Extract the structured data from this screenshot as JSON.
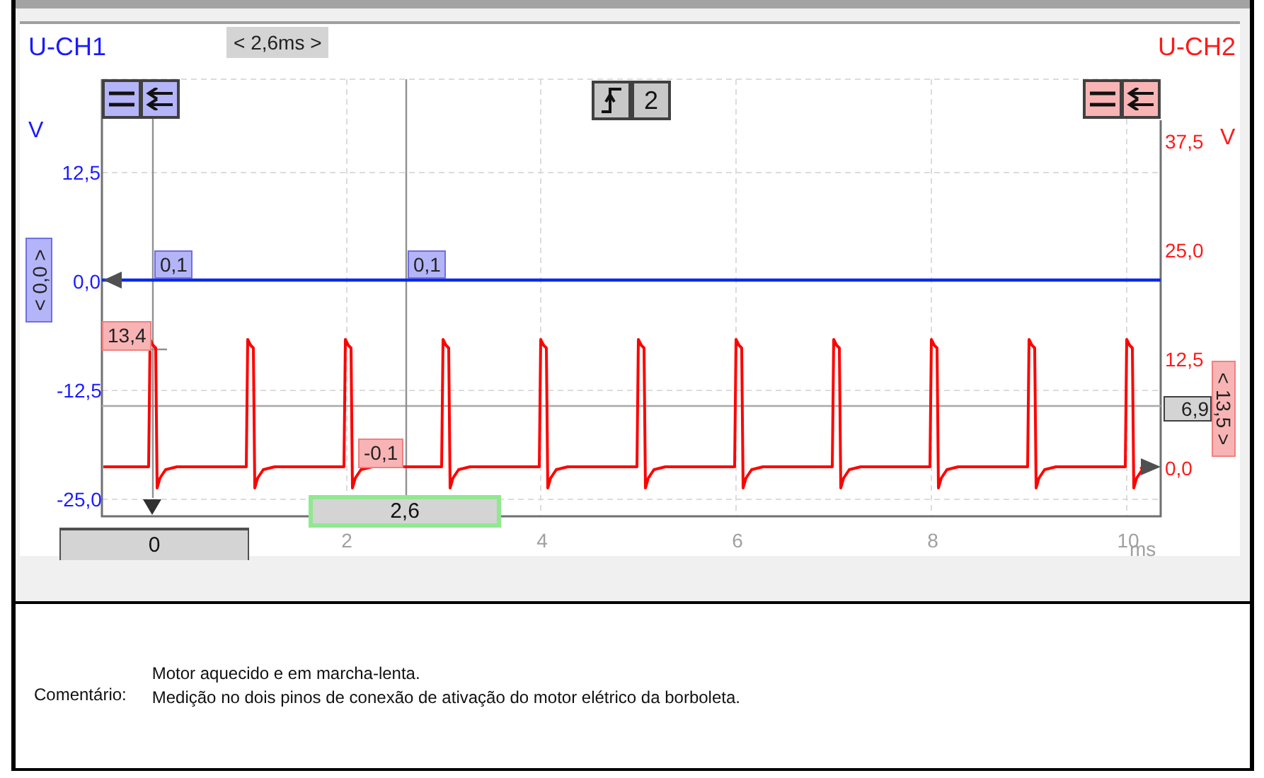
{
  "scope": {
    "channel_1": {
      "title": "U-CH1",
      "unit": "V",
      "ticks": [
        "12,5",
        "0,0",
        "-12,5",
        "-25,0"
      ],
      "offset": "< 0,0 >",
      "cursor_values": [
        "0,1",
        "0,1"
      ]
    },
    "channel_2": {
      "title": "U-CH2",
      "unit": "V",
      "ticks": [
        "37,5",
        "25,0",
        "12,5",
        "0,0"
      ],
      "offset": "< 13,5 >",
      "cursor_values": [
        "13,4",
        "-0,1"
      ],
      "level_marker": "6,9"
    },
    "time_span": "< 2,6ms >",
    "trigger_channel": "2",
    "x_ticks": [
      "2",
      "4",
      "6",
      "8",
      "10"
    ],
    "x_unit": "ms",
    "cursor_positions": [
      "0",
      "2,6"
    ]
  },
  "comment": {
    "label": "Comentário:",
    "lines": [
      "Motor aquecido e em marcha-lenta.",
      "Medição no dois pinos de conexão de ativação do motor elétrico da borboleta."
    ]
  }
}
